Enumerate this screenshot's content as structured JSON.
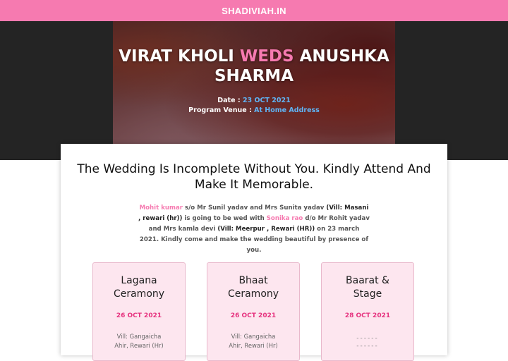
{
  "header": {
    "brand": "SHADIVIAH.IN"
  },
  "hero": {
    "title_part1": "VIRAT KHOLI ",
    "title_weds": "WEDS",
    "title_part2": " ANUSHKA SHARMA",
    "date_label": "Date : ",
    "date_value": "23 OCT 2021",
    "venue_label": "Program Venue : ",
    "venue_value": "At Home Address"
  },
  "invite": {
    "heading": "The Wedding Is Incomplete Without You. Kindly Attend And Make It Memorable.",
    "groom_name": "Mohit kumar",
    "t1": " s/o Mr Sunil yadav and Mrs Sunita yadav ",
    "groom_village": "(Vill: Masani , rewari (hr))",
    "t2": " is going to be wed with ",
    "bride_name": "Sonika rao",
    "t3": " d/o Mr Rohit yadav and Mrs kamla devi ",
    "bride_village": "(Vill: Meerpur , Rewari (HR))",
    "t4": " on 23 march 2021. Kindly come and make the wedding beautiful by presence of you."
  },
  "events": [
    {
      "title_line1": "Lagana",
      "title_line2": "Ceramony",
      "date": "26 OCT 2021",
      "venue_line1": "Vill: Gangaicha",
      "venue_line2": "Ahir, Rewari (Hr)"
    },
    {
      "title_line1": "Bhaat",
      "title_line2": "Ceramony",
      "date": "26 OCT 2021",
      "venue_line1": "Vill: Gangaicha",
      "venue_line2": "Ahir, Rewari (Hr)"
    },
    {
      "title_line1": "Baarat &",
      "title_line2": "Stage",
      "date": "28 OCT 2021",
      "venue_line1": "------",
      "venue_line2": "------"
    }
  ],
  "colors": {
    "accent_pink": "#f67ab0",
    "date_pink": "#e6337f",
    "link_blue": "#5fb4f5",
    "event_bg": "#fde6ef",
    "dark_band": "#242424"
  }
}
